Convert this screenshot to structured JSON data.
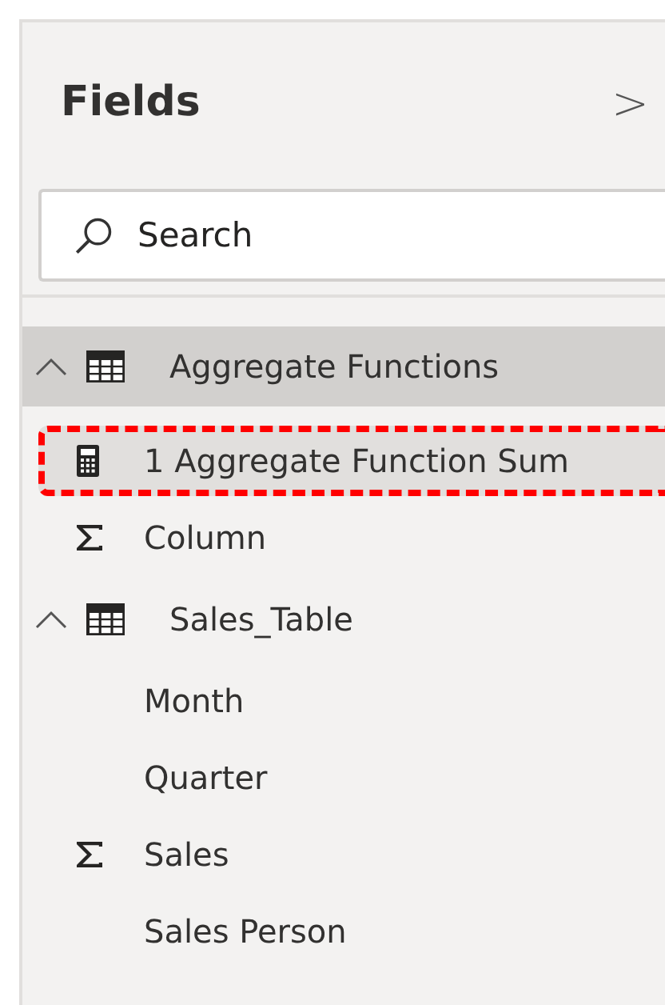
{
  "pane": {
    "title": "Fields",
    "collapse_glyph": ">"
  },
  "search": {
    "placeholder": "Search"
  },
  "tables": [
    {
      "name": "Aggregate Functions",
      "expanded": true,
      "selected": true,
      "children": [
        {
          "name": "1 Aggregate Function Sum",
          "kind": "measure",
          "selected": true,
          "highlighted": true
        },
        {
          "name": "Column",
          "kind": "sum",
          "selected": false,
          "highlighted": false
        }
      ]
    },
    {
      "name": "Sales_Table",
      "expanded": true,
      "selected": false,
      "children": [
        {
          "name": "Month",
          "kind": "text",
          "selected": false,
          "highlighted": false
        },
        {
          "name": "Quarter",
          "kind": "text",
          "selected": false,
          "highlighted": false
        },
        {
          "name": "Sales",
          "kind": "sum",
          "selected": false,
          "highlighted": false
        },
        {
          "name": "Sales Person",
          "kind": "text",
          "selected": false,
          "highlighted": false
        }
      ]
    }
  ]
}
